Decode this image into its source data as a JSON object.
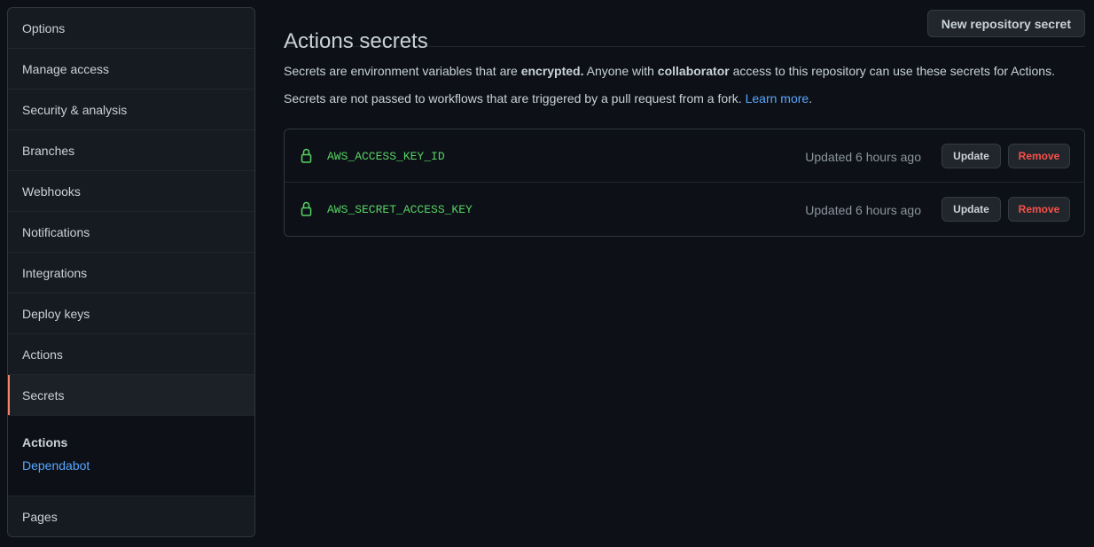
{
  "sidebar": {
    "items": [
      {
        "label": "Options"
      },
      {
        "label": "Manage access"
      },
      {
        "label": "Security & analysis"
      },
      {
        "label": "Branches"
      },
      {
        "label": "Webhooks"
      },
      {
        "label": "Notifications"
      },
      {
        "label": "Integrations"
      },
      {
        "label": "Deploy keys"
      },
      {
        "label": "Actions"
      },
      {
        "label": "Secrets"
      }
    ],
    "selected": "Secrets",
    "sub_section": {
      "heading": "Actions",
      "link": "Dependabot"
    },
    "last_item": "Pages"
  },
  "header": {
    "title": "Actions secrets",
    "new_button": "New repository secret"
  },
  "description": {
    "line1_part1": "Secrets are environment variables that are ",
    "line1_bold1": "encrypted.",
    "line1_part2": " Anyone with ",
    "line1_bold2": "collaborator",
    "line1_part3": " access to this repository can use these secrets for Actions.",
    "line2_text": "Secrets are not passed to workflows that are triggered by a pull request from a fork. ",
    "line2_link": "Learn more",
    "line2_end": "."
  },
  "secrets": [
    {
      "name": "AWS_ACCESS_KEY_ID",
      "updated": "Updated 6 hours ago",
      "update_label": "Update",
      "remove_label": "Remove",
      "icon": "lock-icon"
    },
    {
      "name": "AWS_SECRET_ACCESS_KEY",
      "updated": "Updated 6 hours ago",
      "update_label": "Update",
      "remove_label": "Remove",
      "icon": "lock-icon"
    }
  ],
  "colors": {
    "background": "#0d1117",
    "accent_selected": "#f78166",
    "secret_name": "#56d364",
    "link": "#58a6ff",
    "danger": "#f85149"
  }
}
